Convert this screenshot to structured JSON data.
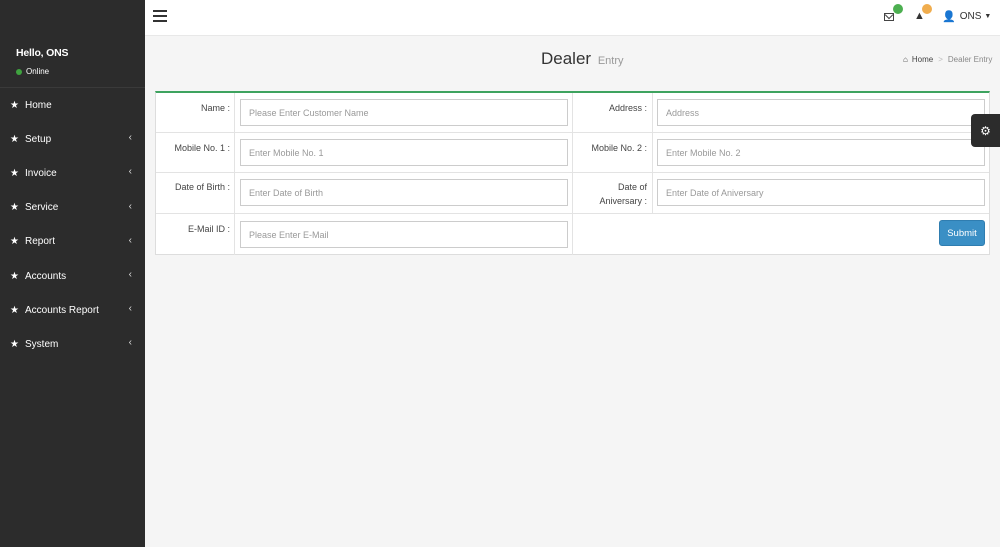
{
  "sidebar": {
    "greeting": "Hello, ONS",
    "status": "Online",
    "items": [
      {
        "label": "Home",
        "has_submenu": false
      },
      {
        "label": "Setup",
        "has_submenu": true
      },
      {
        "label": "Invoice",
        "has_submenu": true
      },
      {
        "label": "Service",
        "has_submenu": true
      },
      {
        "label": "Report",
        "has_submenu": true
      },
      {
        "label": "Accounts",
        "has_submenu": true
      },
      {
        "label": "Accounts Report",
        "has_submenu": true
      },
      {
        "label": "System",
        "has_submenu": true
      }
    ],
    "star_glyph": "★",
    "chevron_glyph": "‹"
  },
  "topbar": {
    "user_name": "ONS",
    "user_icon": "👤",
    "warning_glyph": "▲",
    "caret": "▼",
    "badge_colors": {
      "mail": "#4caf50",
      "alert": "#f0ad4e"
    }
  },
  "header": {
    "title": "Dealer",
    "subtitle": "Entry"
  },
  "breadcrumb": {
    "home_icon": "⌂",
    "home": "Home",
    "separator": ">",
    "current": "Dealer Entry"
  },
  "form": {
    "name_label": "Name :",
    "name_placeholder": "Please Enter Customer Name",
    "address_label": "Address :",
    "address_placeholder": "Address",
    "mobile1_label": "Mobile No. 1 :",
    "mobile1_placeholder": "Enter Mobile No. 1",
    "mobile2_label": "Mobile No. 2 :",
    "mobile2_placeholder": "Enter Mobile No. 2",
    "dob_label": "Date of Birth :",
    "dob_placeholder": "Enter Date of Birth",
    "doa_label_line1": "Date of",
    "doa_label_line2": "Aniversary :",
    "doa_placeholder": "Enter Date of Aniversary",
    "email_label": "E-Mail ID :",
    "email_placeholder": "Please Enter E-Mail",
    "submit_label": "Submit"
  },
  "settings_glyph": "⚙",
  "colors": {
    "sidebar_bg": "#2c2c2c",
    "box_accent": "#3ea35f",
    "submit_bg": "#3a8fc5",
    "online_dot": "#3fa33f"
  }
}
